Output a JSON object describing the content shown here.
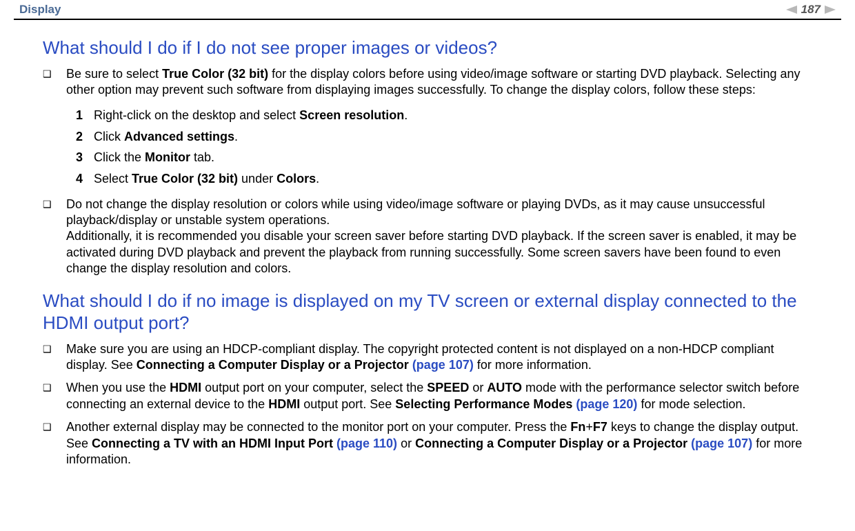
{
  "header": {
    "breadcrumb": "Display",
    "page_number": "187"
  },
  "sections": [
    {
      "title": "What should I do if I do not see proper images or videos?",
      "bullets": [
        {
          "pre": "Be sure to select ",
          "bold1": "True Color (32 bit)",
          "post1": " for the display colors before using video/image software or starting DVD playback. Selecting any other option may prevent such software from displaying images successfully. To change the display colors, follow these steps:",
          "steps": [
            {
              "n": "1",
              "pre": "Right-click on the desktop and select ",
              "bold": "Screen resolution",
              "post": "."
            },
            {
              "n": "2",
              "pre": "Click ",
              "bold": "Advanced settings",
              "post": "."
            },
            {
              "n": "3",
              "pre": "Click the ",
              "bold": "Monitor",
              "post": " tab."
            },
            {
              "n": "4",
              "pre": "Select ",
              "bold": "True Color (32 bit)",
              "mid": " under ",
              "bold2": "Colors",
              "post": "."
            }
          ]
        },
        {
          "text": "Do not change the display resolution or colors while using video/image software or playing DVDs, as it may cause unsuccessful playback/display or unstable system operations.",
          "text2": "Additionally, it is recommended you disable your screen saver before starting DVD playback. If the screen saver is enabled, it may be activated during DVD playback and prevent the playback from running successfully. Some screen savers have been found to even change the display resolution and colors."
        }
      ]
    },
    {
      "title": "What should I do if no image is displayed on my TV screen or external display connected to the HDMI output port?",
      "bullets": [
        {
          "t0": "Make sure you are using an HDCP-compliant display. The copyright protected content is not displayed on a non-HDCP compliant display. See ",
          "b0": "Connecting a Computer Display or a Projector ",
          "l0": "(page 107)",
          "t1": " for more information."
        },
        {
          "t0": "When you use the ",
          "b0": "HDMI",
          "t1": " output port on your computer, select the ",
          "b1": "SPEED",
          "t2": " or ",
          "b2": "AUTO",
          "t3": " mode with the performance selector switch before connecting an external device to the ",
          "b3": "HDMI",
          "t4": " output port. See ",
          "b4": "Selecting Performance Modes ",
          "l0": "(page 120)",
          "t5": " for mode selection."
        },
        {
          "t0": "Another external display may be connected to the monitor port on your computer. Press the ",
          "b0": "Fn",
          "t1": "+",
          "b1": "F7",
          "t2": " keys to change the display output. See ",
          "b2": "Connecting a TV with an HDMI Input Port ",
          "l0": "(page 110)",
          "t3": " or ",
          "b3": "Connecting a Computer Display or a Projector ",
          "l1": "(page 107)",
          "t4": " for more information."
        }
      ]
    }
  ]
}
